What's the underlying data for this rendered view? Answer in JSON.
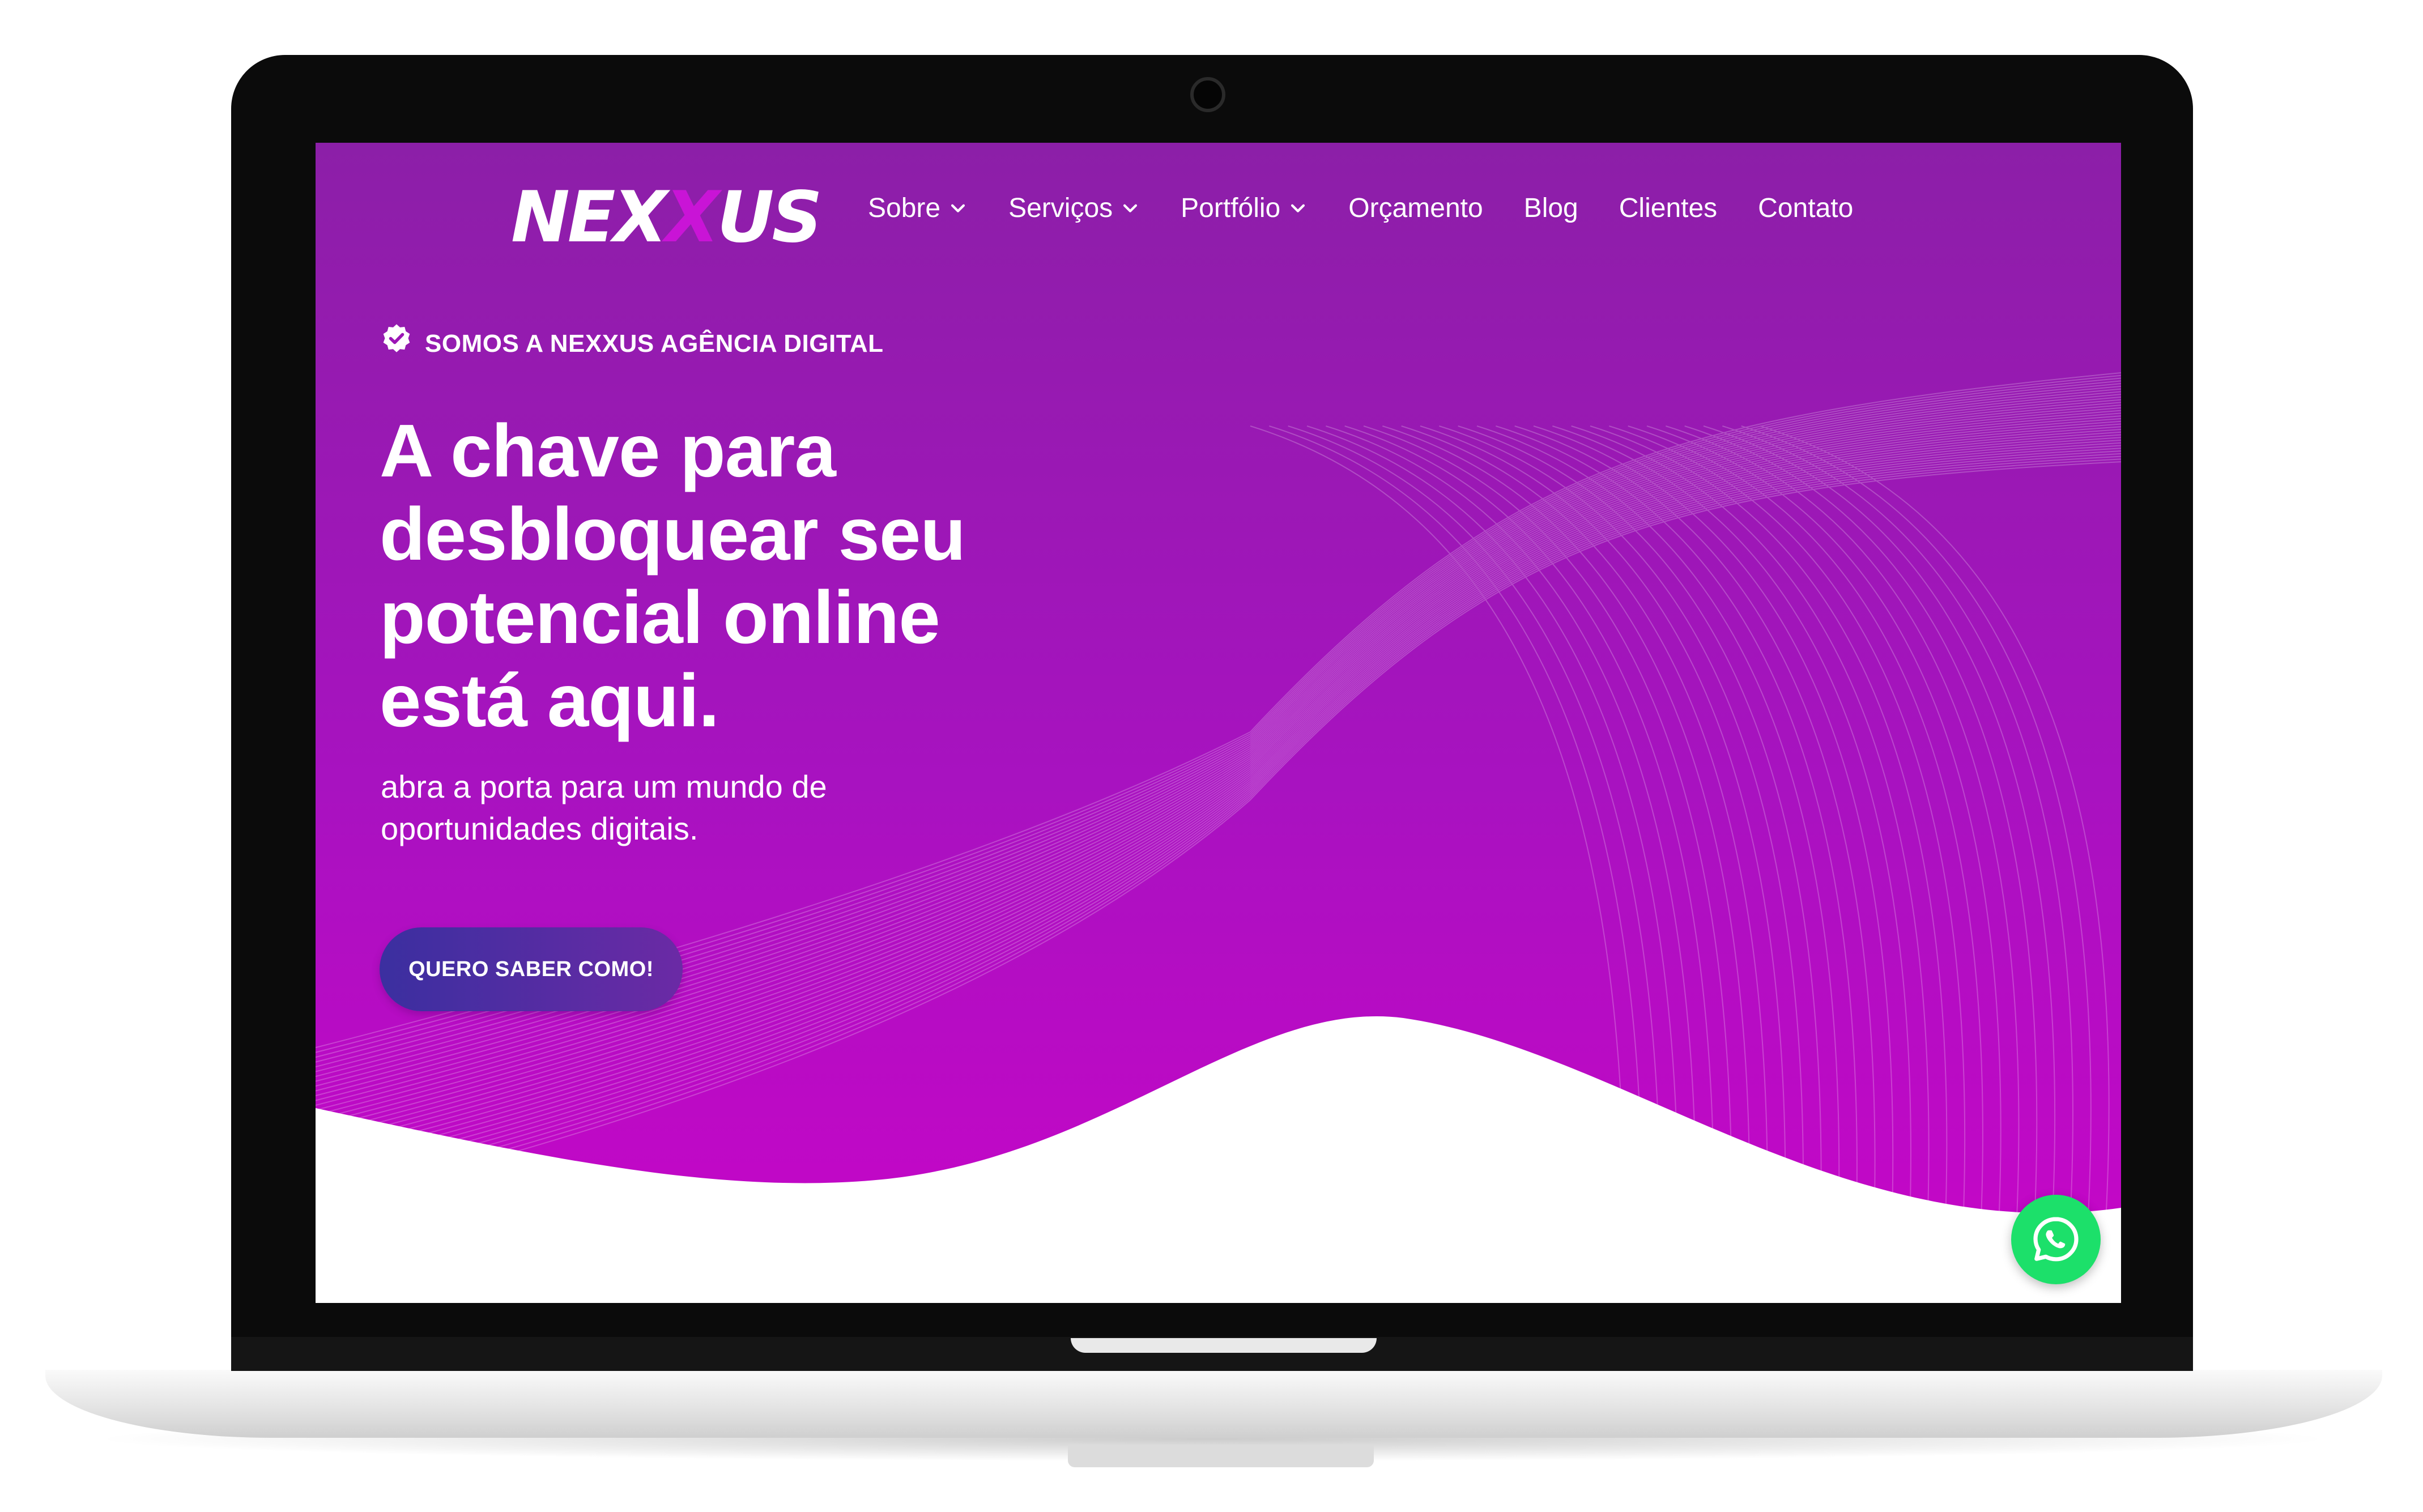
{
  "site": {
    "logo": {
      "part1": "NEX",
      "part2": "X",
      "part3": "US"
    }
  },
  "nav": {
    "items": [
      {
        "label": "Sobre",
        "has_dropdown": true
      },
      {
        "label": "Serviços",
        "has_dropdown": true
      },
      {
        "label": "Portfólio",
        "has_dropdown": true
      },
      {
        "label": "Orçamento",
        "has_dropdown": false
      },
      {
        "label": "Blog",
        "has_dropdown": false
      },
      {
        "label": "Clientes",
        "has_dropdown": false
      },
      {
        "label": "Contato",
        "has_dropdown": false
      }
    ]
  },
  "hero": {
    "badge": "SOMOS A NEXXUS AGÊNCIA DIGITAL",
    "headline": [
      "A chave para",
      "desbloquear seu",
      "potencial online",
      "está aqui."
    ],
    "subtext": [
      "abra a porta para um mundo de",
      "oportunidades digitais."
    ],
    "cta_label": "QUERO SABER COMO!"
  },
  "icons": {
    "badge": "verified-badge-icon",
    "dropdown": "chevron-down-icon",
    "whatsapp": "whatsapp-icon"
  },
  "colors": {
    "gradient_top": "#8c1fa8",
    "gradient_bottom": "#c805c8",
    "cta_start": "#3b2fa0",
    "cta_end": "#6b2aa5",
    "whatsapp": "#1ce06a",
    "logo_accent": "#c914d6"
  }
}
